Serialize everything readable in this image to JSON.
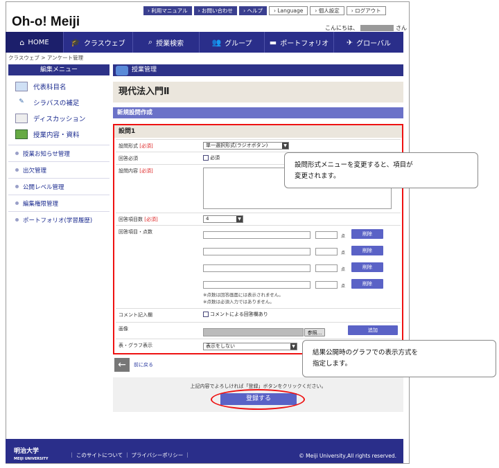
{
  "header": {
    "logo": "Oh-o! Meiji",
    "links": [
      "› 利用マニュアル",
      "› お問い合わせ",
      "› ヘルプ",
      "› Language",
      "› 個人設定",
      "› ログアウト"
    ],
    "greeting_prefix": "こんにちは、",
    "greeting_suffix": "さん"
  },
  "nav": {
    "items": [
      {
        "label": "HOME",
        "icon": "home-icon"
      },
      {
        "label": "クラスウェブ",
        "icon": "graduation-cap-icon"
      },
      {
        "label": "授業検索",
        "icon": "search-icon"
      },
      {
        "label": "グループ",
        "icon": "group-icon"
      },
      {
        "label": "ポートフォリオ",
        "icon": "folder-icon"
      },
      {
        "label": "グローバル",
        "icon": "plane-icon"
      }
    ]
  },
  "breadcrumb": "クラスウェブ > アンケート管理",
  "sidebar": {
    "title": "編集メニュー",
    "big_items": [
      "代表科目名",
      "シラバスの補足",
      "ディスカッション",
      "授業内容・資料"
    ],
    "small_items": [
      "授業お知らせ管理",
      "出欠管理",
      "公開レベル管理",
      "編集権限管理",
      "ポートフォリオ(学習履歴)"
    ]
  },
  "main": {
    "section_title": "授業管理",
    "course_title": "現代法入門Ⅱ",
    "subtitle": "新規設問作成"
  },
  "form": {
    "question_label": "設問1",
    "rows": {
      "format_label": "設問形式",
      "required_tag": "[必須]",
      "format_value": "単一選択形式(ラジオボタン)",
      "answer_req_label": "回答必須",
      "answer_req_check": "必須",
      "content_label": "設問内容",
      "count_label": "回答項目数",
      "count_value": "4",
      "items_label": "回答項目・点数",
      "point_unit": "点",
      "delete_label": "削除",
      "note1": "※点数は回答画面には表示されません。",
      "note2": "※点数は必須入力ではありません。",
      "comment_label": "コメント記入欄",
      "comment_check": "コメントによる回答欄あり",
      "image_label": "画像",
      "browse_label": "参照...",
      "add_label": "追加",
      "graph_label": "表・グラフ表示",
      "graph_value": "表示をしない"
    }
  },
  "callouts": {
    "c1": "設問形式メニューを変更すると、項目が\n変更されます。",
    "c2": "結果公開時のグラフでの表示方式を\n指定します。"
  },
  "back_label": "前に戻る",
  "confirm": {
    "text": "上記内容でよろしければ「登録」ボタンをクリックください。",
    "button": "登録する"
  },
  "footer": {
    "logo": "明治大学",
    "logo_sub": "MEIJI UNIVERSITY",
    "links": "｜ このサイトについて ｜ プライバシーポリシー ｜",
    "copyright": "© Meiji University,All rights reserved."
  }
}
